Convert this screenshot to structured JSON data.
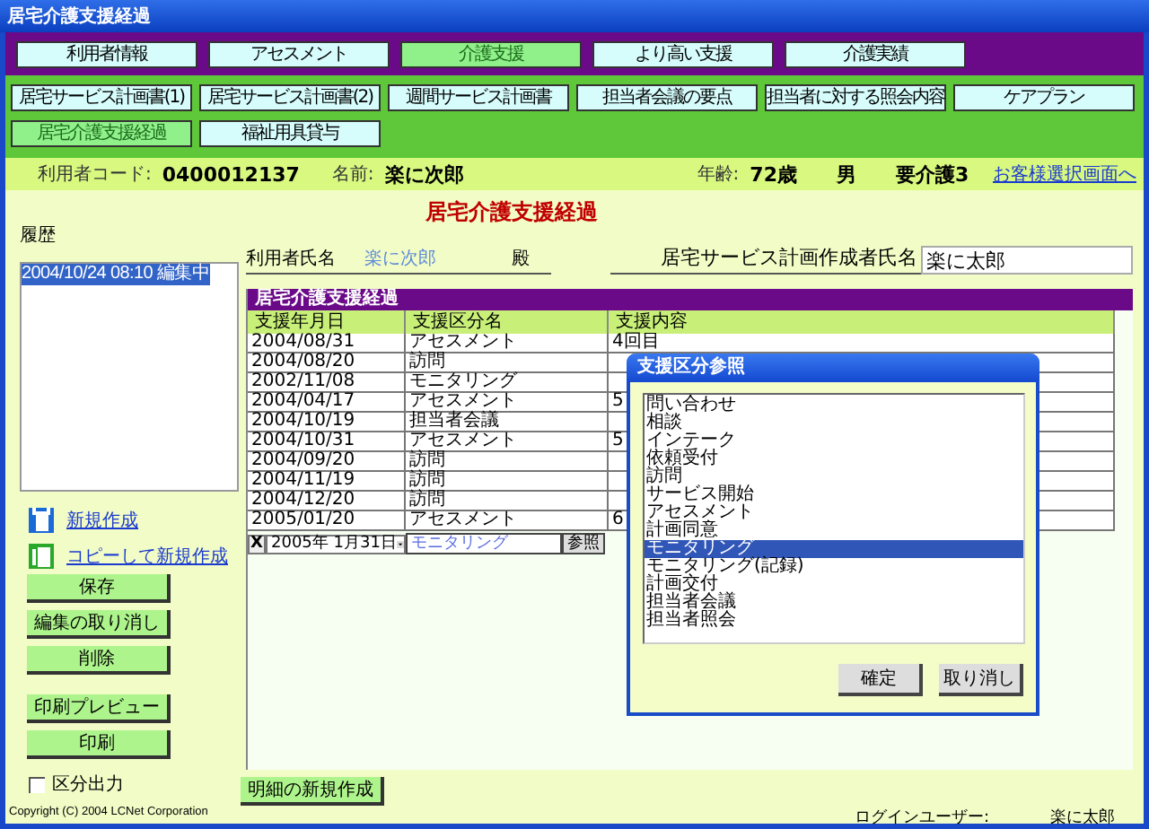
{
  "window": {
    "title": "居宅介護支援経過"
  },
  "nav_tabs": [
    {
      "label": "利用者情報",
      "selected": false
    },
    {
      "label": "アセスメント",
      "selected": false
    },
    {
      "label": "介護支援",
      "selected": true
    },
    {
      "label": "より高い支援",
      "selected": false
    },
    {
      "label": "介護実績",
      "selected": false
    }
  ],
  "sub_tabs": [
    {
      "label": "居宅サービス計画書(1)",
      "selected": false
    },
    {
      "label": "居宅サービス計画書(2)",
      "selected": false
    },
    {
      "label": "週間サービス計画書",
      "selected": false
    },
    {
      "label": "担当者会議の要点",
      "selected": false
    },
    {
      "label": "担当者に対する照会内容",
      "selected": false
    },
    {
      "label": "ケアプラン",
      "selected": false
    },
    {
      "label": "居宅介護支援経過",
      "selected": true
    },
    {
      "label": "福祉用具貸与",
      "selected": false
    }
  ],
  "info": {
    "code_label": "利用者コード:",
    "code": "0400012137",
    "name_label": "名前:",
    "name": "楽に次郎",
    "age_label": "年齢:",
    "age": "72歳",
    "sex": "男",
    "care_level": "要介護3",
    "link": "お客様選択画面へ"
  },
  "left": {
    "history_label": "履歴",
    "history": [
      {
        "label": "2004/10/24 08:10 編集中",
        "selected": true
      }
    ],
    "links": [
      {
        "label": "新規作成",
        "kind": "new"
      },
      {
        "label": "コピーして新規作成",
        "kind": "copy"
      }
    ],
    "button_groups": [
      [
        "保存",
        "編集の取り消し",
        "削除"
      ],
      [
        "印刷プレビュー",
        "印刷"
      ]
    ],
    "checkbox": {
      "label": "区分出力",
      "checked": false
    }
  },
  "form": {
    "title": "居宅介護支援経過",
    "user_label": "利用者氏名",
    "user_name": "楽に次郎",
    "honorific": "殿",
    "planner_label": "居宅サービス計画作成者氏名",
    "planner_value": "楽に太郎"
  },
  "table": {
    "title": "居宅介護支援経過",
    "columns": [
      "支援年月日",
      "支援区分名",
      "支援内容"
    ],
    "rows": [
      {
        "date": "2004/08/31",
        "kind": "アセスメント",
        "content": "4回目"
      },
      {
        "date": "2004/08/20",
        "kind": "訪問"
      },
      {
        "date": "2002/11/08",
        "kind": "モニタリング"
      },
      {
        "date": "2004/04/17",
        "kind": "アセスメント",
        "content": "5"
      },
      {
        "date": "2004/10/19",
        "kind": "担当者会議"
      },
      {
        "date": "2004/10/31",
        "kind": "アセスメント",
        "content": "5"
      },
      {
        "date": "2004/09/20",
        "kind": "訪問"
      },
      {
        "date": "2004/11/19",
        "kind": "訪問"
      },
      {
        "date": "2004/12/20",
        "kind": "訪問"
      },
      {
        "date": "2005/01/20",
        "kind": "アセスメント",
        "content": "6"
      }
    ],
    "editor": {
      "clear": "X",
      "date": "2005年 1月31日",
      "value": "モニタリング",
      "ref_button": "参照"
    }
  },
  "dialog": {
    "title": "支援区分参照",
    "items": [
      {
        "label": "問い合わせ",
        "selected": false
      },
      {
        "label": "相談",
        "selected": false
      },
      {
        "label": "インテーク",
        "selected": false
      },
      {
        "label": "依頼受付",
        "selected": false
      },
      {
        "label": "訪問",
        "selected": false
      },
      {
        "label": "サービス開始",
        "selected": false
      },
      {
        "label": "アセスメント",
        "selected": false
      },
      {
        "label": "計画同意",
        "selected": false
      },
      {
        "label": "モニタリング",
        "selected": true
      },
      {
        "label": "モニタリング(記録)",
        "selected": false
      },
      {
        "label": "計画交付",
        "selected": false
      },
      {
        "label": "担当者会議",
        "selected": false
      },
      {
        "label": "担当者照会",
        "selected": false
      }
    ],
    "buttons": [
      "確定",
      "取り消し"
    ]
  },
  "footer": {
    "copyright": "Copyright (C) 2004 LCNet Corporation",
    "new_detail_button": "明細の新規作成",
    "login_label": "ログインユーザー:",
    "login_user": "楽に太郎"
  }
}
